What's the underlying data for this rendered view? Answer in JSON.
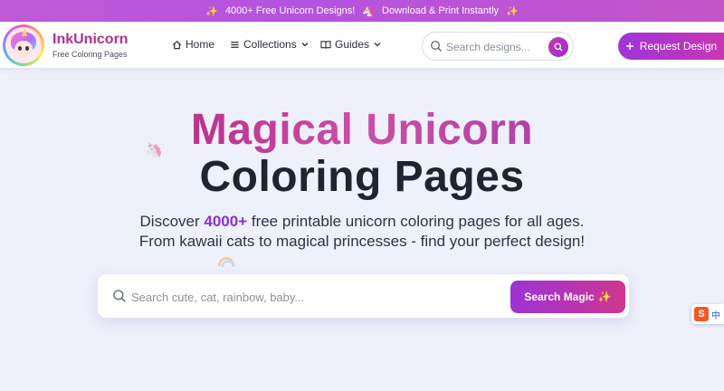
{
  "announcement": {
    "text_1": "4000+ Free Unicorn Designs!",
    "text_2": "Download & Print Instantly"
  },
  "brand": {
    "name": "InkUnicorn",
    "tagline": "Free Coloring Pages"
  },
  "nav": {
    "home": "Home",
    "collections": "Collections",
    "guides": "Guides"
  },
  "header_search": {
    "placeholder": "Search designs..."
  },
  "request_button": {
    "label": "Request Design"
  },
  "hero": {
    "title_1": "Magical Unicorn",
    "title_2": "Coloring Pages",
    "sub_prefix": "Discover ",
    "sub_count": "4000+",
    "sub_rest": " free printable unicorn coloring pages for all ages.",
    "sub_line2": "From kawaii cats to magical princesses - find your perfect design!"
  },
  "main_search": {
    "placeholder": "Search cute, cat, rainbow, baby...",
    "button_label": "Search Magic"
  },
  "ime": {
    "logo": "S",
    "label": "中"
  },
  "colors": {
    "accent_pink": "#c23f98",
    "accent_purple": "#9b33d6",
    "background": "#eef0fb"
  }
}
